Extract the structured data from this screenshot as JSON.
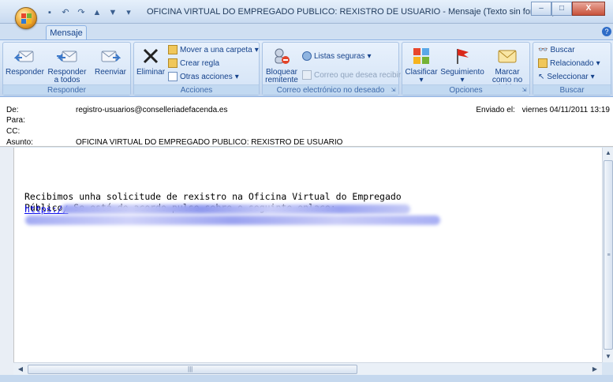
{
  "window": {
    "title": "OFICINA VIRTUAL DO EMPREGADO PUBLICO: REXISTRO DE USUARIO - Mensaje (Texto sin formato)",
    "minimize_glyph": "–",
    "maximize_glyph": "□",
    "close_glyph": "X"
  },
  "tabs": [
    {
      "label": "Mensaje"
    }
  ],
  "help_glyph": "?",
  "ribbon": {
    "groups": {
      "responder": {
        "label": "Responder",
        "buttons": [
          "Responder",
          "Responder a todos",
          "Reenviar"
        ]
      },
      "acciones": {
        "label": "Acciones",
        "eliminar": "Eliminar",
        "mover": "Mover a una carpeta",
        "crear_regla": "Crear regla",
        "otras": "Otras acciones"
      },
      "correo_no_deseado": {
        "label": "Correo electrónico no deseado",
        "bloquear": "Bloquear remitente",
        "listas": "Listas seguras",
        "correo_recibir": "Correo que desea recibir"
      },
      "opciones": {
        "label": "Opciones",
        "clasificar": "Clasificar",
        "seguimiento": "Seguimiento",
        "marcar": "Marcar como no leído"
      },
      "buscar": {
        "label": "Buscar",
        "buscar": "Buscar",
        "relacionado": "Relacionado",
        "seleccionar": "Seleccionar"
      }
    }
  },
  "headers": {
    "de_label": "De:",
    "de_value": "registro-usuarios@conselleriadefacenda.es",
    "para_label": "Para:",
    "cc_label": "CC:",
    "asunto_label": "Asunto:",
    "asunto_value": "OFICINA VIRTUAL DO EMPREGADO PUBLICO: REXISTRO DE USUARIO",
    "enviado_label": "Enviado el:",
    "enviado_value": "viernes 04/11/2011 13:19"
  },
  "body": {
    "text": "Recibimos unha solicitude de rexistro na Oficina Virtual do Empregado\nPúblico. Se está de acordo pulse sobre o seguinte enlace:",
    "link_prefix": "https://"
  },
  "colors": {
    "ribbon_bg": "#d2e1f3",
    "link": "#0000ee",
    "redacted": "#9ea6f2"
  }
}
